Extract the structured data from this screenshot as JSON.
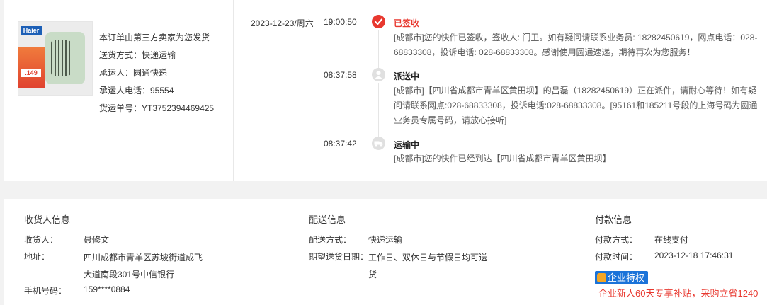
{
  "product": {
    "brand_logo": "Haier",
    "promo_price": ".149",
    "seller_note": "本订单由第三方卖家为您发货",
    "delivery_method": "送货方式：快递运输",
    "carrier": "承运人：圆通快递",
    "carrier_phone": "承运人电话：95554",
    "tracking_no": "货运单号：YT3752394469425"
  },
  "timeline": [
    {
      "date": "2023-12-23/周六",
      "time": "19:00:50",
      "status": "已签收",
      "icon": "check-circle-icon",
      "active": true,
      "desc": "[成都市]您的快件已签收，签收人: 门卫。如有疑问请联系业务员: 18282450619，网点电话：028-68833308，投诉电话: 028-68833308。感谢使用圆通速递，期待再次为您服务！"
    },
    {
      "date": "",
      "time": "08:37:58",
      "status": "派送中",
      "icon": "courier-icon",
      "active": false,
      "desc": "[成都市]【四川省成都市青羊区黄田坝】的吕磊（18282450619）正在派件，请耐心等待！如有疑问请联系网点:028-68833308，投诉电话:028-68833308。[95161和185211号段的上海号码为圆通业务员专属号码，请放心接听]"
    },
    {
      "date": "",
      "time": "08:37:42",
      "status": "运输中",
      "icon": "truck-icon",
      "active": false,
      "desc": "[成都市]您的快件已经到达【四川省成都市青羊区黄田坝】"
    }
  ],
  "receiver": {
    "title": "收货人信息",
    "name_label": "收货人：",
    "name": "聂修文",
    "address_label": "地址：",
    "address": "四川成都市青羊区苏坡街道成飞大道南段301号中信银行",
    "phone_label": "手机号码：",
    "phone": "159****0884"
  },
  "delivery": {
    "title": "配送信息",
    "method_label": "配送方式：",
    "method": "快递运输",
    "date_label": "期望送货日期：",
    "date": "工作日、双休日与节假日均可送货"
  },
  "payment": {
    "title": "付款信息",
    "method_label": "付款方式：",
    "method": "在线支付",
    "time_label": "付款时间：",
    "time": "2023-12-18 17:46:31"
  },
  "enterprise": {
    "badge": "企业特权",
    "promo": "企业新人60天专享补贴，采购立省1240"
  },
  "colors": {
    "accent": "#e8382f",
    "badge_blue": "#1a73d9"
  }
}
